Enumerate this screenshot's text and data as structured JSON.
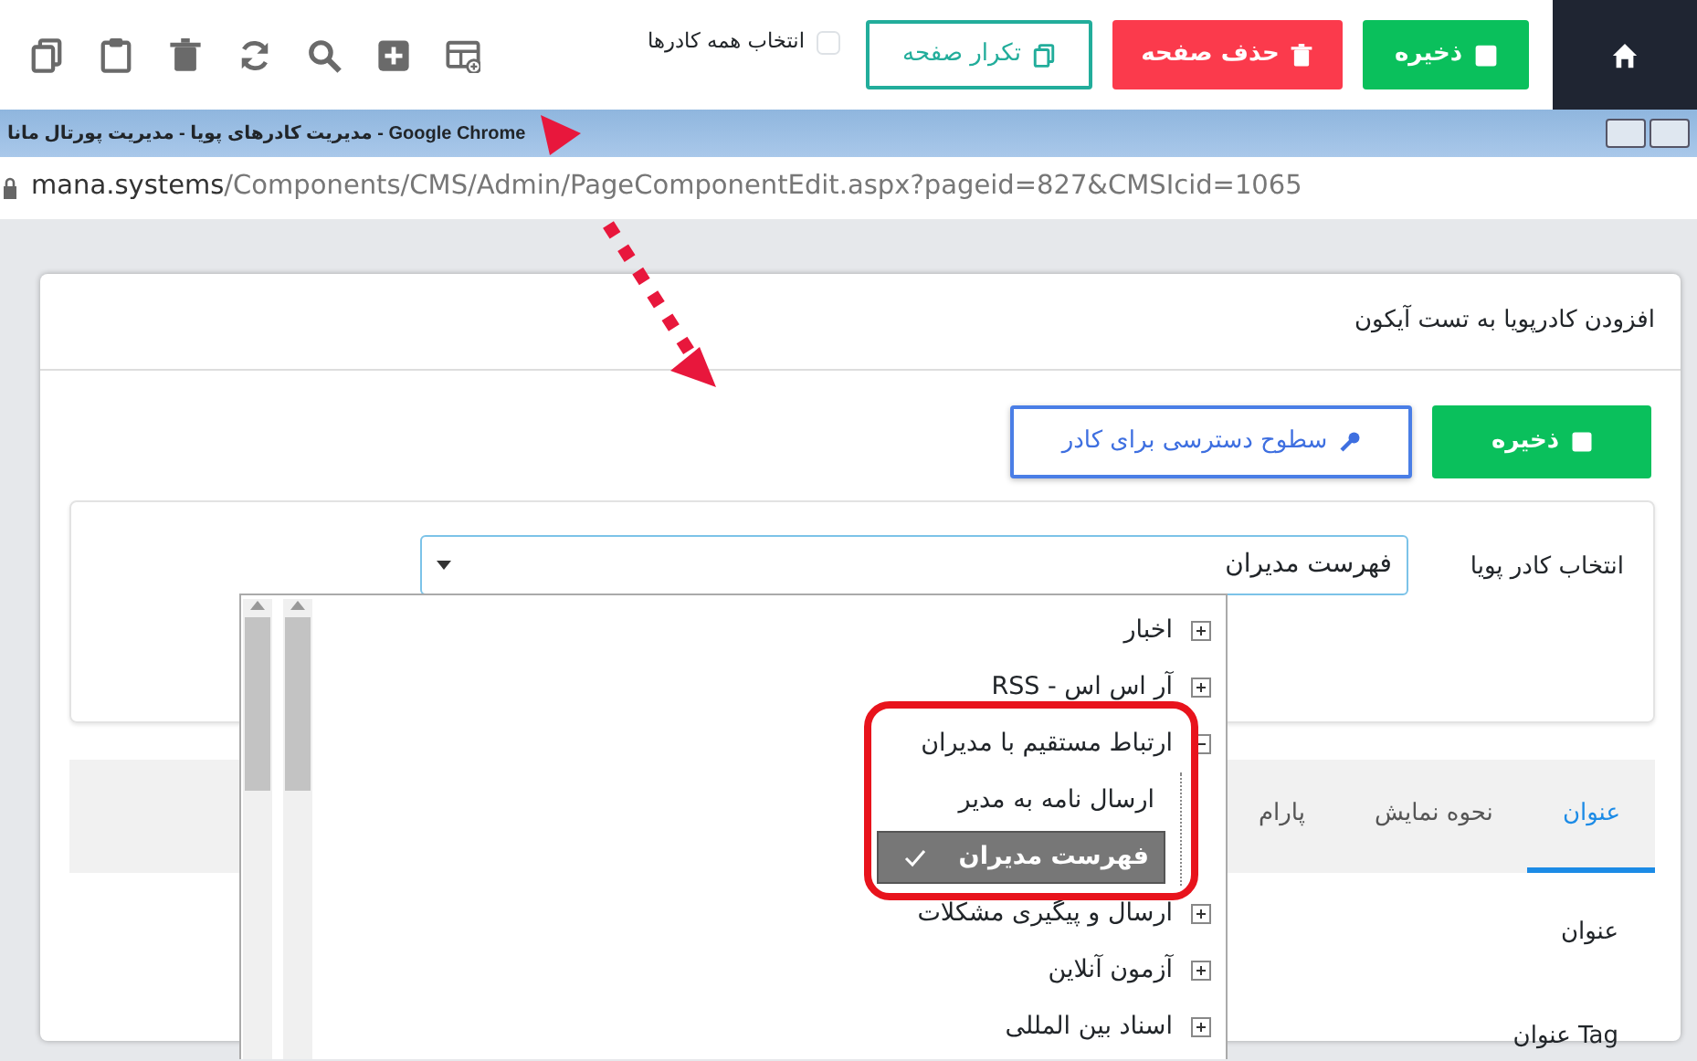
{
  "toolbar": {
    "buttons": [
      {
        "label": "ذخیره",
        "kind": "success"
      },
      {
        "label": "حذف صفحه",
        "kind": "danger"
      },
      {
        "label": "تکرار صفحه",
        "kind": "outline"
      }
    ],
    "select_all": {
      "label": "انتخاب همه کادرها",
      "checked": false
    }
  },
  "browser": {
    "title": "مدیریت کادرهای پویا - مدیریت پورتال مانا - Google Chrome",
    "url_host": "mana.systems",
    "url_path": "/Components/CMS/Admin/PageComponentEdit.aspx?pageid=827&CMSIcid=1065"
  },
  "card": {
    "title": "افزودن کادرپویا به تست آیکون",
    "buttons": [
      {
        "label": "ذخیره",
        "kind": "success"
      },
      {
        "label": "سطوح دسترسی برای کادر",
        "kind": "outline"
      }
    ],
    "select": {
      "label": "انتخاب کادر پویا",
      "value": "فهرست مدیران",
      "expanded": true
    },
    "tree": [
      {
        "label": "اخبار",
        "expanded": false,
        "selected": false
      },
      {
        "label": "آر اس اس - RSS",
        "expanded": false,
        "selected": false
      },
      {
        "label": "ارتباط مستقیم با مدیران",
        "expanded": true,
        "selected": false,
        "children": [
          {
            "label": "ارسال نامه به مدیر",
            "selected": false
          },
          {
            "label": "فهرست مدیران",
            "selected": true
          }
        ]
      },
      {
        "label": "ارسال و پیگیری مشکلات",
        "expanded": false,
        "selected": false
      },
      {
        "label": "آزمون آنلاین",
        "expanded": false,
        "selected": false
      },
      {
        "label": "اسناد بین المللی",
        "expanded": false,
        "selected": false
      }
    ],
    "tabs": [
      {
        "label": "عنوان",
        "selected": true
      },
      {
        "label": "نحوه نمایش",
        "selected": false
      },
      {
        "label": "پارام",
        "selected": false
      }
    ],
    "fields": [
      {
        "label": "عنوان"
      },
      {
        "label": "Tag عنوان"
      }
    ]
  }
}
